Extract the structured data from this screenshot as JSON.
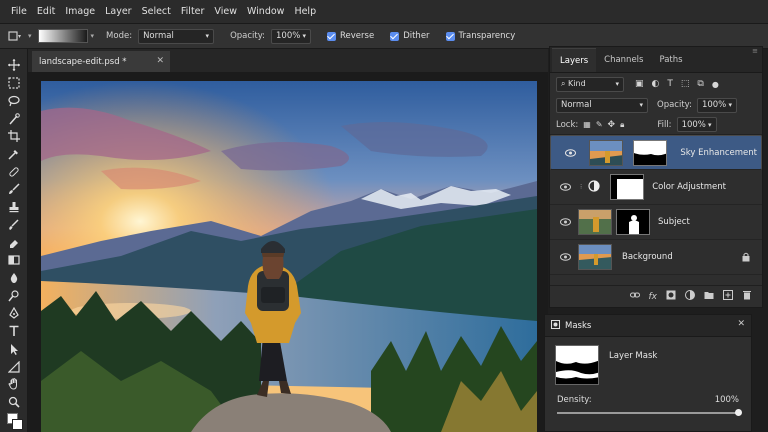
{
  "menu": [
    "File",
    "Edit",
    "Image",
    "Layer",
    "Select",
    "Filter",
    "View",
    "Window",
    "Help"
  ],
  "options": {
    "mode_label": "Mode:",
    "mode_value": "Normal",
    "opacity_label": "Opacity:",
    "opacity_value": "100%",
    "reverse": "Reverse",
    "dither": "Dither",
    "transparency": "Transparency"
  },
  "document": {
    "tab": "landscape-edit.psd *"
  },
  "layers_panel": {
    "tabs": [
      "Layers",
      "Channels",
      "Paths"
    ],
    "filter": "Kind",
    "blend": "Normal",
    "opacity_label": "Opacity:",
    "opacity_value": "100%",
    "lock_label": "Lock:",
    "fill_label": "Fill:",
    "fill_value": "100%",
    "layers": [
      {
        "name": "Sky Enhancement",
        "selected": true
      },
      {
        "name": "Color Adjustment",
        "selected": false
      },
      {
        "name": "Subject",
        "selected": false
      },
      {
        "name": "Background",
        "selected": false
      }
    ]
  },
  "masks_panel": {
    "title": "Masks",
    "mask_name": "Layer Mask",
    "density_label": "Density:",
    "density_value": "100%",
    "density": 1.0
  },
  "colors": {
    "accent": "#5b8def",
    "selected_layer": "#3d5a85"
  }
}
